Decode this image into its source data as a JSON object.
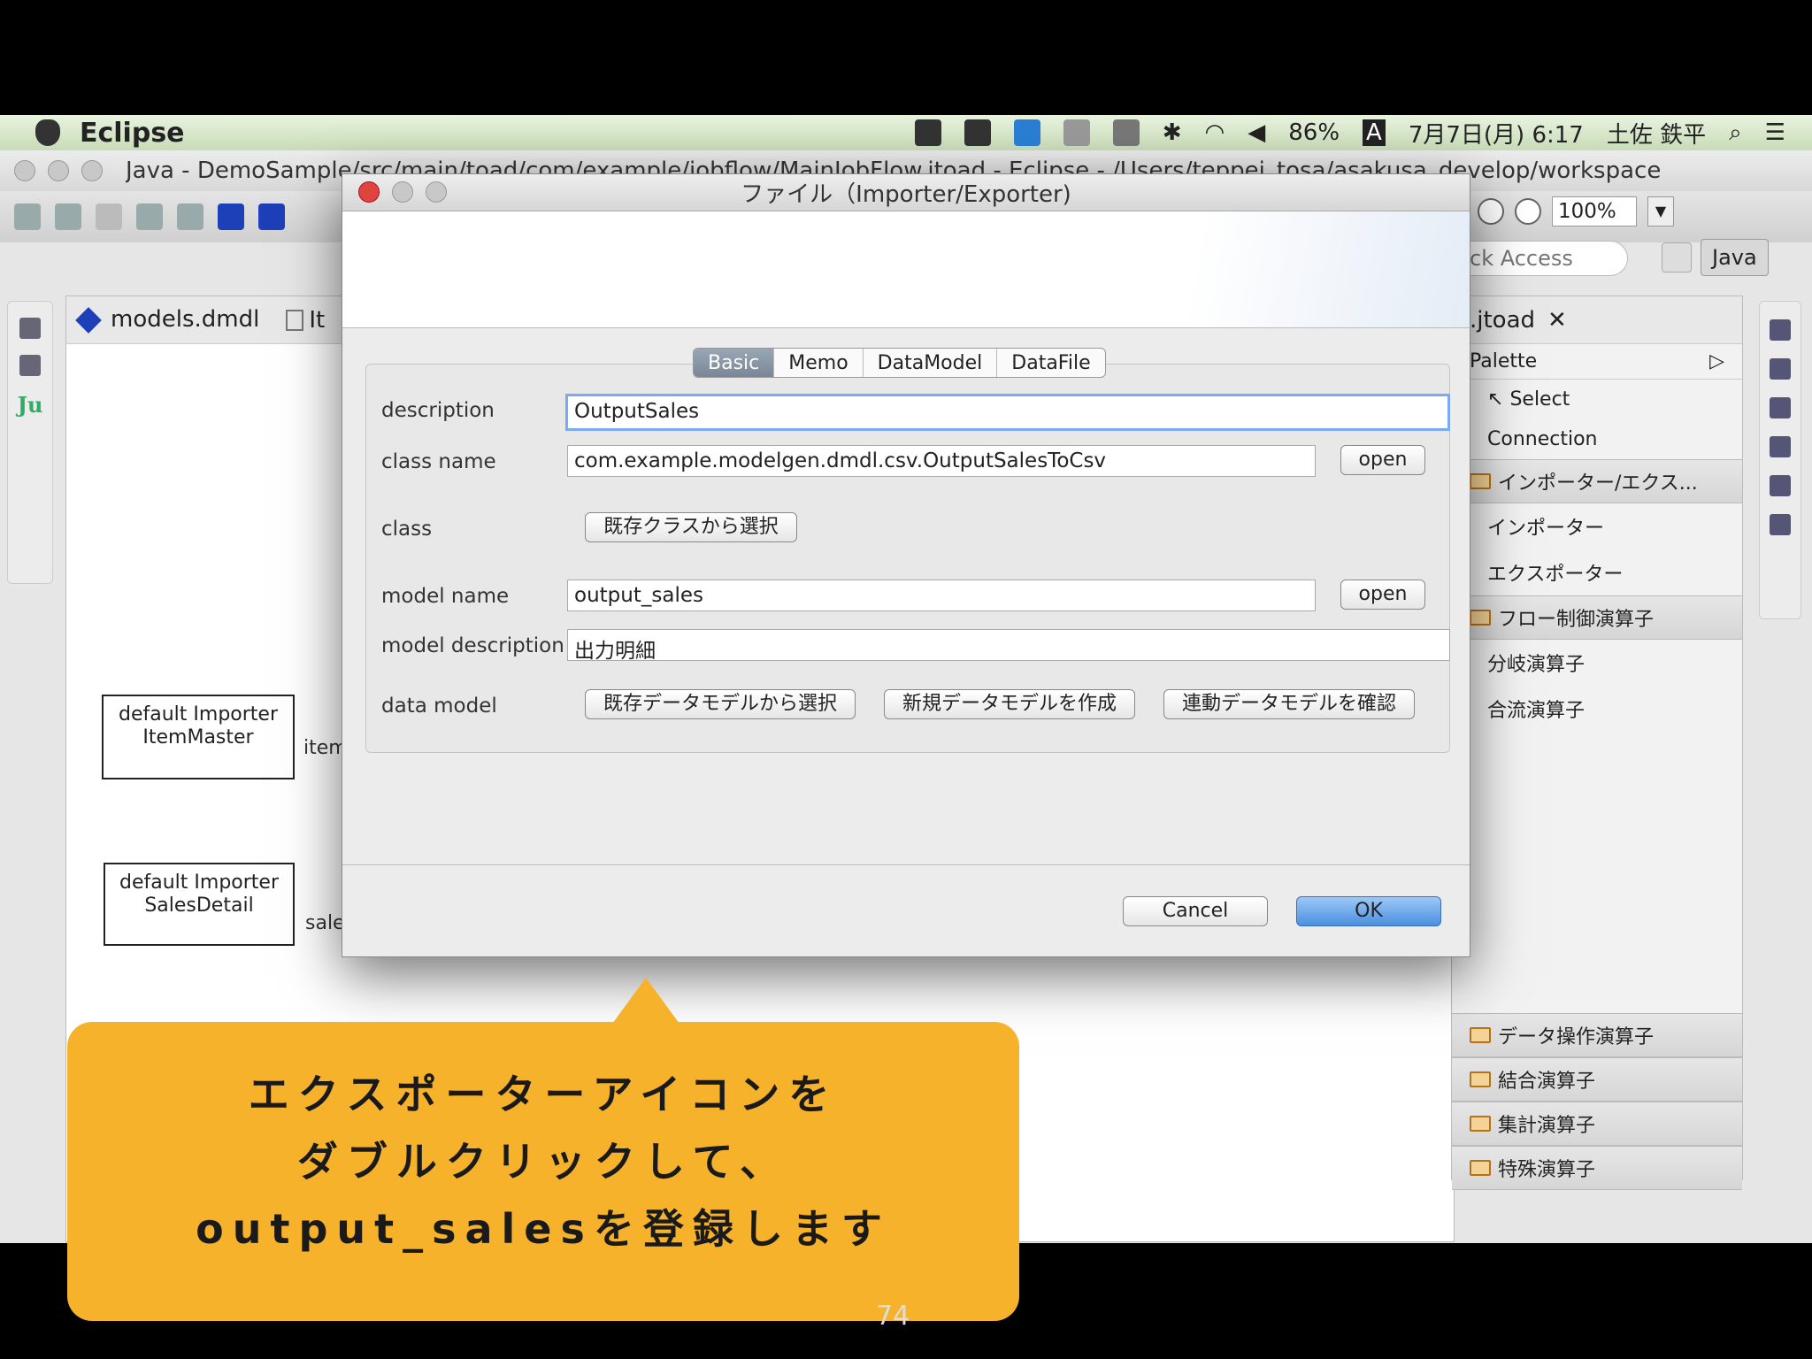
{
  "menubar": {
    "app_name": "Eclipse",
    "battery": "86%",
    "datetime": "7月7日(月) 6:17",
    "user": "土佐 鉄平",
    "input_indicator": "A"
  },
  "eclipse_window": {
    "title": "Java - DemoSample/src/main/toad/com/example/jobflow/MainJobFlow.jtoad - Eclipse - /Users/teppei_tosa/asakusa_develop/workspace",
    "zoom": "100%",
    "quick_access_placeholder": "ck Access",
    "perspective": "Java"
  },
  "editor": {
    "tabs": [
      "models.dmdl",
      "It"
    ],
    "nodes": [
      {
        "line1": "default Importer",
        "line2": "ItemMaster",
        "edge": "item"
      },
      {
        "line1": "default Importer",
        "line2": "SalesDetail",
        "edge": "sale"
      }
    ]
  },
  "palette": {
    "tab_label": ".jtoad",
    "header": "Palette",
    "tools": [
      "Select",
      "Connection"
    ],
    "drawer_io": "インポーター/エクス...",
    "io_items": [
      "インポーター",
      "エクスポーター"
    ],
    "drawer_flow": "フロー制御演算子",
    "flow_items": [
      "分岐演算子",
      "合流演算子"
    ],
    "bottom_drawers": [
      "データ操作演算子",
      "結合演算子",
      "集計演算子",
      "特殊演算子"
    ]
  },
  "dialog": {
    "title": "ファイル（Importer/Exporter)",
    "tabs": [
      "Basic",
      "Memo",
      "DataModel",
      "DataFile"
    ],
    "active_tab": "Basic",
    "labels": {
      "description": "description",
      "class_name": "class name",
      "class": "class",
      "model_name": "model name",
      "model_description": "model description",
      "data_model": "data model"
    },
    "values": {
      "description": "OutputSales",
      "class_name": "com.example.modelgen.dmdl.csv.OutputSalesToCsv",
      "model_name": "output_sales",
      "model_description": "出力明細"
    },
    "buttons": {
      "open": "open",
      "select_existing_class": "既存クラスから選択",
      "select_existing_model": "既存データモデルから選択",
      "create_new_model": "新規データモデルを作成",
      "check_linked_model": "連動データモデルを確認",
      "cancel": "Cancel",
      "ok": "OK"
    }
  },
  "callout": {
    "line1": "エクスポーターアイコンを",
    "line2": "ダブルクリックして、",
    "line3": "output_salesを登録します"
  },
  "slide_number": "74",
  "colors": {
    "callout": "#f7b22c",
    "ok_button": "#4c8fe0",
    "focus_ring": "#7aaaf0"
  }
}
